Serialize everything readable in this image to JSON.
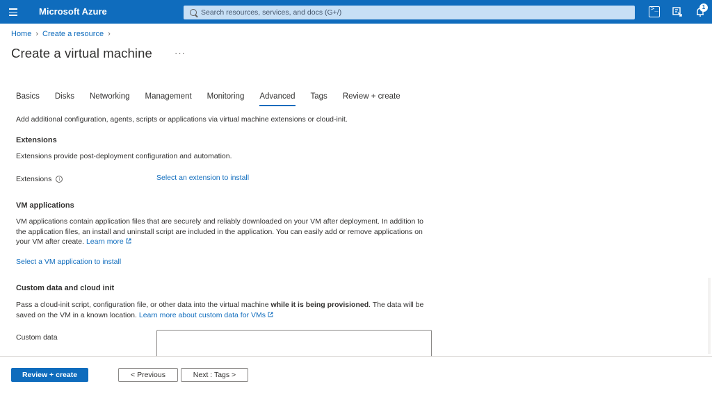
{
  "header": {
    "brand": "Microsoft Azure",
    "search_placeholder": "Search resources, services, and docs (G+/)",
    "notification_count": "1"
  },
  "breadcrumb": [
    "Home",
    "Create a resource"
  ],
  "page": {
    "title": "Create a virtual machine",
    "more": "···"
  },
  "tabs": [
    {
      "label": "Basics"
    },
    {
      "label": "Disks"
    },
    {
      "label": "Networking"
    },
    {
      "label": "Management"
    },
    {
      "label": "Monitoring"
    },
    {
      "label": "Advanced",
      "active": true
    },
    {
      "label": "Tags"
    },
    {
      "label": "Review + create"
    }
  ],
  "advanced": {
    "intro": "Add additional configuration, agents, scripts or applications via virtual machine extensions or cloud-init.",
    "extensions": {
      "heading": "Extensions",
      "description": "Extensions provide post-deployment configuration and automation.",
      "label": "Extensions",
      "link": "Select an extension to install"
    },
    "vm_apps": {
      "heading": "VM applications",
      "description": "VM applications contain application files that are securely and reliably downloaded on your VM after deployment. In addition to the application files, an install and uninstall script are included in the application. You can easily add or remove applications on your VM after create.",
      "learn_more": "Learn more",
      "link": "Select a VM application to install"
    },
    "custom_data": {
      "heading": "Custom data and cloud init",
      "description_pre": "Pass a cloud-init script, configuration file, or other data into the virtual machine ",
      "description_bold": "while it is being provisioned",
      "description_post": ". The data will be saved on the VM in a known location.",
      "learn_more": "Learn more about custom data for VMs",
      "label": "Custom data",
      "value": ""
    }
  },
  "footer": {
    "review_create": "Review + create",
    "previous": "< Previous",
    "next": "Next : Tags >"
  },
  "colors": {
    "accent": "#0f6cbd",
    "text": "#323130"
  }
}
